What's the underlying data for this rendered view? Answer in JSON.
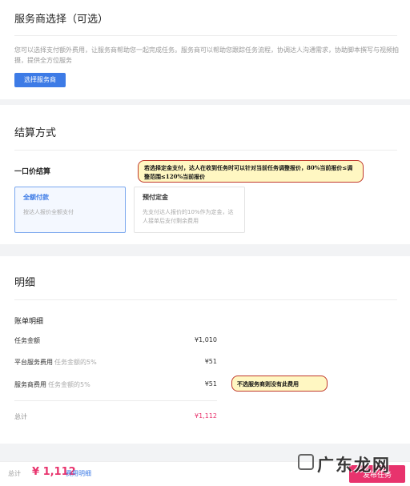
{
  "provider_section": {
    "title": "服务商选择（可选）",
    "description": "您可以选择支付额外费用，让服务商帮助您一起完成任务。服务商可以帮助您跟踪任务流程，协调达人沟通需求，协助脚本撰写与视频拍摄，提供全方位服务",
    "select_button": "选择服务商"
  },
  "settlement_section": {
    "title": "结算方式",
    "method_label": "一口价结算",
    "options": [
      {
        "title": "全额付款",
        "desc": "按达人报价全额支付",
        "selected": true
      },
      {
        "title": "预付定金",
        "desc": "先支付达人报价的10%作为定金，达人接单后支付剩余费用",
        "selected": false
      }
    ],
    "annotation": "若选择定金支付，达人在收到任务时可以针对当前任务调整报价，80%当前报价≤调整范围≤120%当前报价"
  },
  "detail_section": {
    "title": "明细",
    "bill_label": "账单明细",
    "rows": [
      {
        "label": "任务金额",
        "hint": "",
        "amount": "¥1,010"
      },
      {
        "label": "平台服务费用",
        "hint": "任务金额的5%",
        "amount": "¥51"
      },
      {
        "label": "服务商费用",
        "hint": "任务金额的5%",
        "amount": "¥51"
      }
    ],
    "total_label": "总计",
    "total_amount": "¥1,112",
    "annotation": "不选服务商则没有此费用"
  },
  "footer": {
    "total_label": "总计",
    "total_amount": "¥ 1,112",
    "detail_link": "费用明细",
    "publish_button": "发布任务"
  },
  "watermark": {
    "text": "广东龙网"
  },
  "colors": {
    "accent_blue": "#3d7be6",
    "accent_pink": "#e8336d",
    "note_bg": "#fff7c2",
    "note_border": "#c0392b"
  }
}
